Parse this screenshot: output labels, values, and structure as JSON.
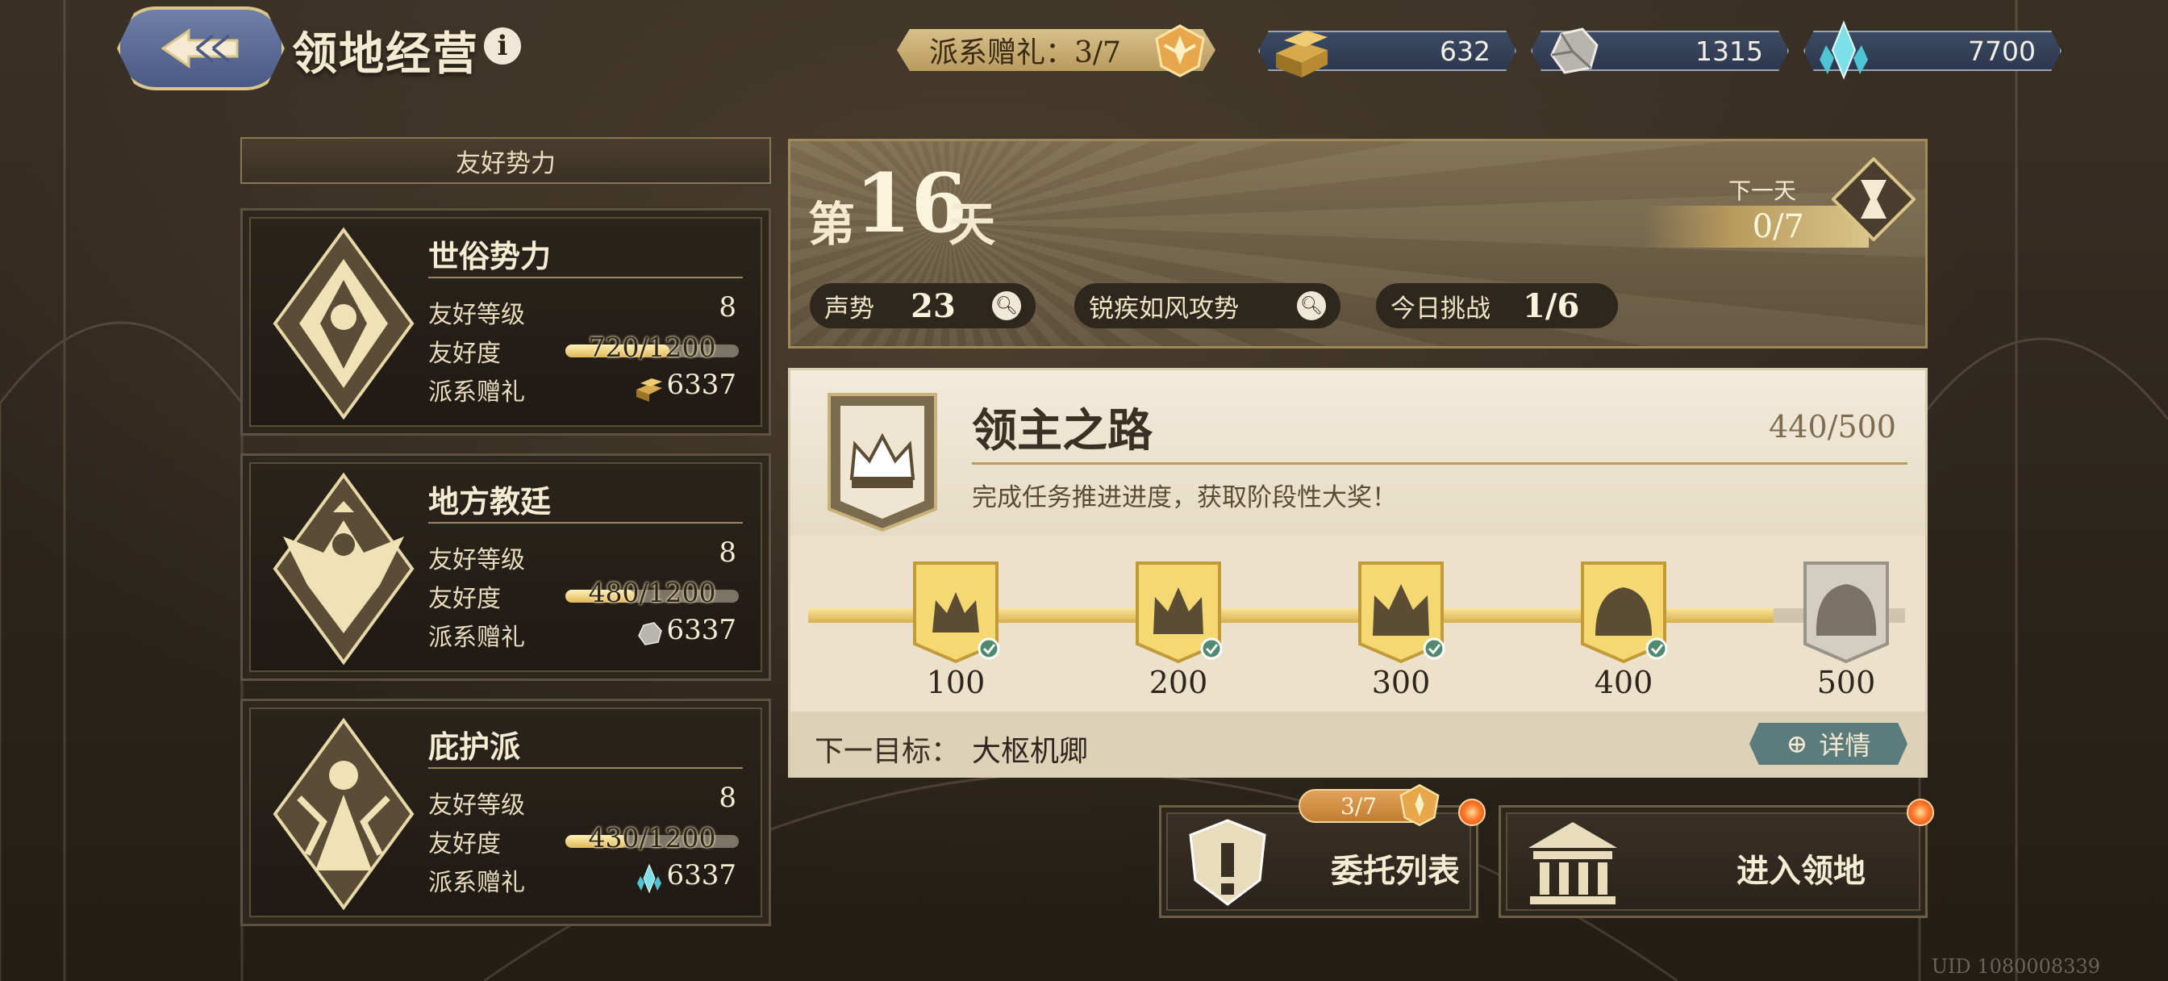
{
  "header": {
    "title": "领地经营",
    "gift_label": "派系赠礼：3/7",
    "resources": [
      {
        "name": "gold-bar",
        "value": "632"
      },
      {
        "name": "ore",
        "value": "1315"
      },
      {
        "name": "crystal",
        "value": "7700"
      }
    ]
  },
  "factions": {
    "header": "友好势力",
    "level_label": "友好等级",
    "affinity_label": "友好度",
    "gift_label": "派系赠礼",
    "items": [
      {
        "name": "世俗势力",
        "level": "8",
        "affinity": "720/1200",
        "affinity_fraction": 0.6,
        "gift_value": "6337",
        "gift_icon": "gold-bar-icon"
      },
      {
        "name": "地方教廷",
        "level": "8",
        "affinity": "480/1200",
        "affinity_fraction": 0.4,
        "gift_value": "6337",
        "gift_icon": "ore-icon"
      },
      {
        "name": "庇护派",
        "level": "8",
        "affinity": "430/1200",
        "affinity_fraction": 0.358,
        "gift_value": "6337",
        "gift_icon": "crystal-icon"
      }
    ]
  },
  "day": {
    "prefix": "第",
    "number": "16",
    "suffix": "天",
    "next_day_label": "下一天",
    "next_day_progress": "0/7",
    "stats": [
      {
        "label": "声势",
        "value": "23"
      },
      {
        "label": "锐疾如风攻势",
        "value": ""
      },
      {
        "label": "今日挑战",
        "value": "1/6"
      }
    ]
  },
  "road": {
    "title": "领主之路",
    "progress": "440/500",
    "progress_fraction": 0.88,
    "description": "完成任务推进进度，获取阶段性大奖！",
    "milestones": [
      {
        "label": "100",
        "done": true
      },
      {
        "label": "200",
        "done": true
      },
      {
        "label": "300",
        "done": true
      },
      {
        "label": "400",
        "done": true
      },
      {
        "label": "500",
        "done": false
      }
    ],
    "next_goal_label": "下一目标：",
    "next_goal_value": "大枢机卿",
    "detail_button": "详情"
  },
  "actions": {
    "commission_label": "委托列表",
    "commission_badge": "3/7",
    "enter_label": "进入领地"
  },
  "footer": {
    "uid": "UID 1080008339"
  },
  "colors": {
    "gold": "#d7b04e",
    "panel_dark": "#2a241c",
    "parchment": "#ece3d0",
    "teal_button": "#5b7b7c"
  }
}
